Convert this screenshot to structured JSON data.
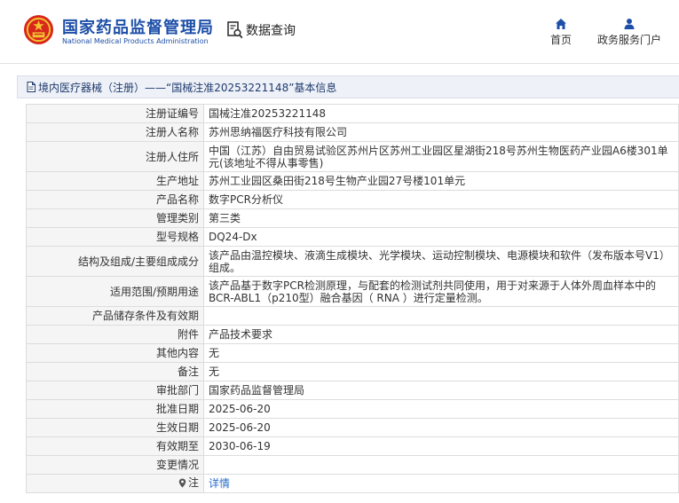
{
  "site": {
    "name_cn": "国家药品监督管理局",
    "name_en": "National Medical Products Administration",
    "query_label": "数据查询"
  },
  "nav": {
    "home": "首页",
    "portal": "政务服务门户"
  },
  "breadcrumb": "境内医疗器械（注册）——“国械注准20253221148”基本信息",
  "rows": [
    {
      "key": "注册证编号",
      "value": "国械注准20253221148"
    },
    {
      "key": "注册人名称",
      "value": "苏州思纳福医疗科技有限公司"
    },
    {
      "key": "注册人住所",
      "value": "中国（江苏）自由贸易试验区苏州片区苏州工业园区星湖街218号苏州生物医药产业园A6楼301单元(该地址不得从事零售)"
    },
    {
      "key": "生产地址",
      "value": "苏州工业园区桑田街218号生物产业园27号楼101单元"
    },
    {
      "key": "产品名称",
      "value": "数字PCR分析仪"
    },
    {
      "key": "管理类别",
      "value": "第三类"
    },
    {
      "key": "型号规格",
      "value": "DQ24-Dx"
    },
    {
      "key": "结构及组成/主要组成成分",
      "value": "该产品由温控模块、液滴生成模块、光学模块、运动控制模块、电源模块和软件（发布版本号V1）组成。"
    },
    {
      "key": "适用范围/预期用途",
      "value": "该产品基于数字PCR检测原理，与配套的检测试剂共同使用，用于对来源于人体外周血样本中的BCR-ABL1（p210型）融合基因（ RNA ）进行定量检测。"
    },
    {
      "key": "产品储存条件及有效期",
      "value": ""
    },
    {
      "key": "附件",
      "value": "产品技术要求"
    },
    {
      "key": "其他内容",
      "value": "无"
    },
    {
      "key": "备注",
      "value": "无"
    },
    {
      "key": "审批部门",
      "value": "国家药品监督管理局"
    },
    {
      "key": "批准日期",
      "value": "2025-06-20"
    },
    {
      "key": "生效日期",
      "value": "2025-06-20"
    },
    {
      "key": "有效期至",
      "value": "2030-06-19"
    },
    {
      "key": "变更情况",
      "value": ""
    },
    {
      "key": "注",
      "value": "详情",
      "icon": "location-pin-icon"
    }
  ],
  "colors": {
    "brand": "#1e4fa8",
    "crumb_bg": "#eef1f7",
    "label_bg": "#f5f5f5",
    "link": "#2a6dc9"
  }
}
